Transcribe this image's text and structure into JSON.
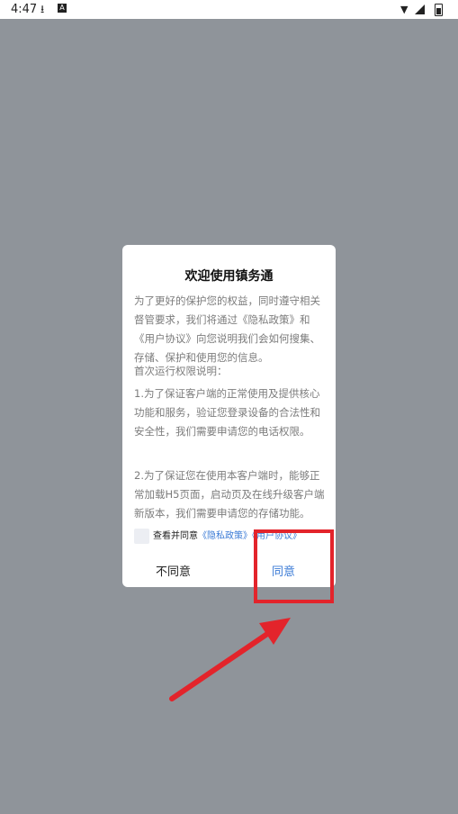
{
  "status_bar": {
    "time": "4:47",
    "download_glyph": "⭳",
    "a_glyph": "A",
    "wifi_glyph": "▼"
  },
  "dialog": {
    "title": "欢迎使用镇务通",
    "intro": "为了更好的保护您的权益，同时遵守相关督管要求，我们将通过《隐私政策》和《用户协议》向您说明我们会如何搜集、存储、保护和使用您的信息。",
    "permissions_heading": "首次运行权限说明：",
    "permission_1": "1.为了保证客户端的正常使用及提供核心功能和服务，验证您登录设备的合法性和安全性，我们需要申请您的电话权限。",
    "permission_2": "2.为了保证您在使用本客户端时，能够正常加载H5页面，启动页及在线升级客户端新版本，我们需要申请您的存储功能。",
    "agree_prefix": "查看并同意",
    "privacy_link": "《隐私政策》",
    "user_agreement_link": "《用户协议》",
    "disagree_label": "不同意",
    "agree_label": "同意"
  },
  "colors": {
    "backdrop": "#8f949a",
    "link": "#3b7bd6",
    "annotation_red": "#e3242b"
  }
}
